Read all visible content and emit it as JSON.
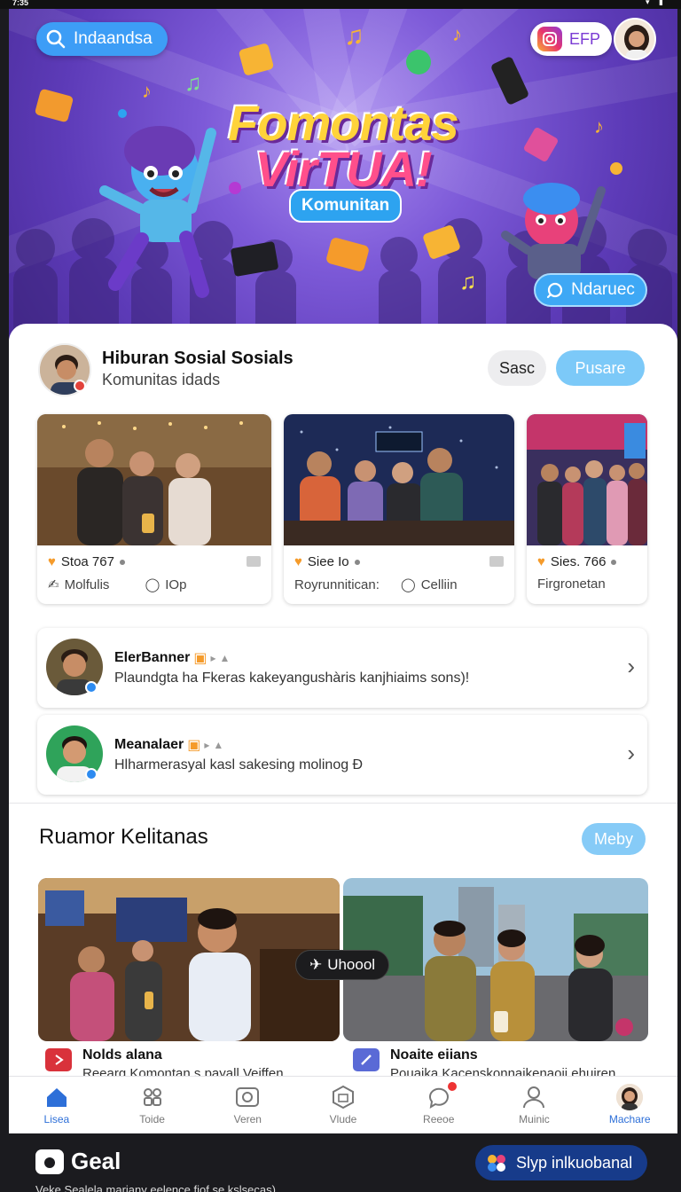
{
  "status": {
    "time": "7:35",
    "icons": "▾ ▮"
  },
  "hero": {
    "search_label": "Indaandsa",
    "badge_label": "EFP",
    "title_line1": "Fomontas",
    "title_line2": "VirTUA!",
    "subtitle": "Komunitan",
    "cta_label": "Ndaruec"
  },
  "profile": {
    "name": "Hiburan Sosial Sosials",
    "subtitle": "Komunitas idads",
    "btn_secondary": "Sasc",
    "btn_primary": "Pusare"
  },
  "cards": [
    {
      "title": "Stoa 767",
      "meta_left": "Molfulis",
      "meta_right": "IOp"
    },
    {
      "title": "Siee Io",
      "meta_left": "Royrunnitican:",
      "meta_right": "Celliin"
    },
    {
      "title": "Sies. 766",
      "meta_left": "Firgronetan",
      "meta_right": ""
    }
  ],
  "messages": [
    {
      "name": "ElerBanner",
      "text": "Plaundgta ha Fkeras kakeyangushàris kanjhiaims sons)!"
    },
    {
      "name": "Meanalaer",
      "text": "Hlharmerasyal kasl sakesing molinog Ɖ"
    }
  ],
  "section": {
    "title": "Ruamor Kelitanas",
    "action": "Meby",
    "chip": "Uhoool",
    "feed": [
      {
        "title": "Nolds alana",
        "text": "Reearg Komontan s payall Veiffen"
      },
      {
        "title": "Noaite eiians",
        "text": "Pouaika Kacenskonnaikenaoii ehuiren"
      }
    ]
  },
  "nav": [
    {
      "label": "Lisea",
      "icon": "home-icon"
    },
    {
      "label": "Toide",
      "icon": "grid-icon"
    },
    {
      "label": "Veren",
      "icon": "video-icon"
    },
    {
      "label": "Vlude",
      "icon": "cube-icon"
    },
    {
      "label": "Reeoe",
      "icon": "chat-icon"
    },
    {
      "label": "Muinic",
      "icon": "person-icon"
    },
    {
      "label": "Machare",
      "icon": "avatar"
    }
  ],
  "bottom": {
    "title": "Geal",
    "button": "Slyp inlkuobanal",
    "footer": "Veke Sealela mariany eelence fiof se kslsecas)"
  },
  "colors": {
    "accent": "#3d9df6",
    "hero_purple": "#7d5ad8",
    "active_nav": "#2d6fd8"
  }
}
